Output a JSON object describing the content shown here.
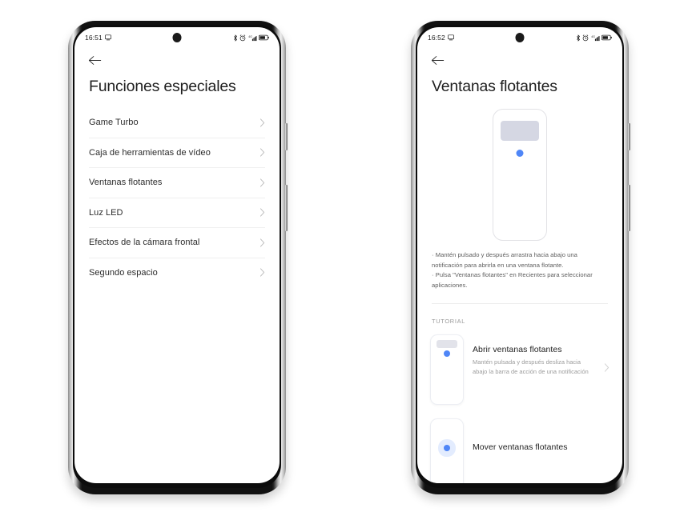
{
  "phones": [
    {
      "id": "left",
      "status_bar": {
        "time": "16:51",
        "left_icons": [
          "screenshot-icon"
        ],
        "right_icons": [
          "bluetooth-icon",
          "alarm-icon",
          "signal-4g-icon",
          "battery-icon"
        ]
      },
      "back_button": "back-arrow-icon",
      "page_title": "Funciones especiales",
      "list": [
        {
          "label": "Game Turbo"
        },
        {
          "label": "Caja de herramientas de vídeo"
        },
        {
          "label": "Ventanas flotantes"
        },
        {
          "label": "Luz LED"
        },
        {
          "label": "Efectos de la cámara frontal"
        },
        {
          "label": "Segundo espacio"
        }
      ]
    },
    {
      "id": "right",
      "status_bar": {
        "time": "16:52",
        "left_icons": [
          "screenshot-icon"
        ],
        "right_icons": [
          "bluetooth-icon",
          "alarm-icon",
          "signal-4g-icon",
          "battery-icon"
        ]
      },
      "back_button": "back-arrow-icon",
      "page_title": "Ventanas flotantes",
      "description": "· Mantén pulsado y después arrastra hacia abajo una notificación para abrirla en una ventana flotante.\n· Pulsa \"Ventanas flotantes\" en Recientes para seleccionar aplicaciones.",
      "section_label": "TUTORIAL",
      "tutorials": [
        {
          "title": "Abrir ventanas flotantes",
          "subtitle": "Mantén pulsada y después desliza hacia abajo la barra de acción de una notificación"
        },
        {
          "title": "Mover ventanas flotantes",
          "subtitle": ""
        }
      ]
    }
  ],
  "colors": {
    "accent_blue": "#4f86f7",
    "notification_grey": "#d5d7e3",
    "text_primary": "#1f1f1f",
    "text_secondary": "#9b9b9b",
    "background": "#ffffff"
  }
}
